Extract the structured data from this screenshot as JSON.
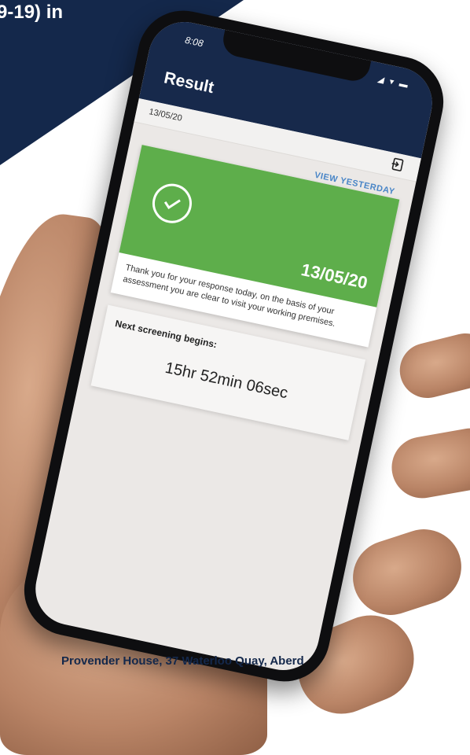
{
  "banner": {
    "text": "9-19) in"
  },
  "status_bar": {
    "time": "8:08",
    "icons": "◢ ▾ ▬"
  },
  "header": {
    "title": "Result"
  },
  "date_bar": {
    "date": "13/05/20"
  },
  "view_yesterday_label": "VIEW YESTERDAY",
  "result": {
    "date": "13/05/20",
    "message": "Thank you for your response today, on the basis of your assessment you are clear to visit your working premises."
  },
  "next_screening": {
    "label": "Next screening begins:",
    "countdown": "15hr 52min 06sec"
  },
  "footer": {
    "address": "Provender House, 37 Waterloo Quay, Aberd"
  },
  "colors": {
    "navy": "#17294b",
    "green": "#5eae4b",
    "link_blue": "#4a86c7"
  }
}
